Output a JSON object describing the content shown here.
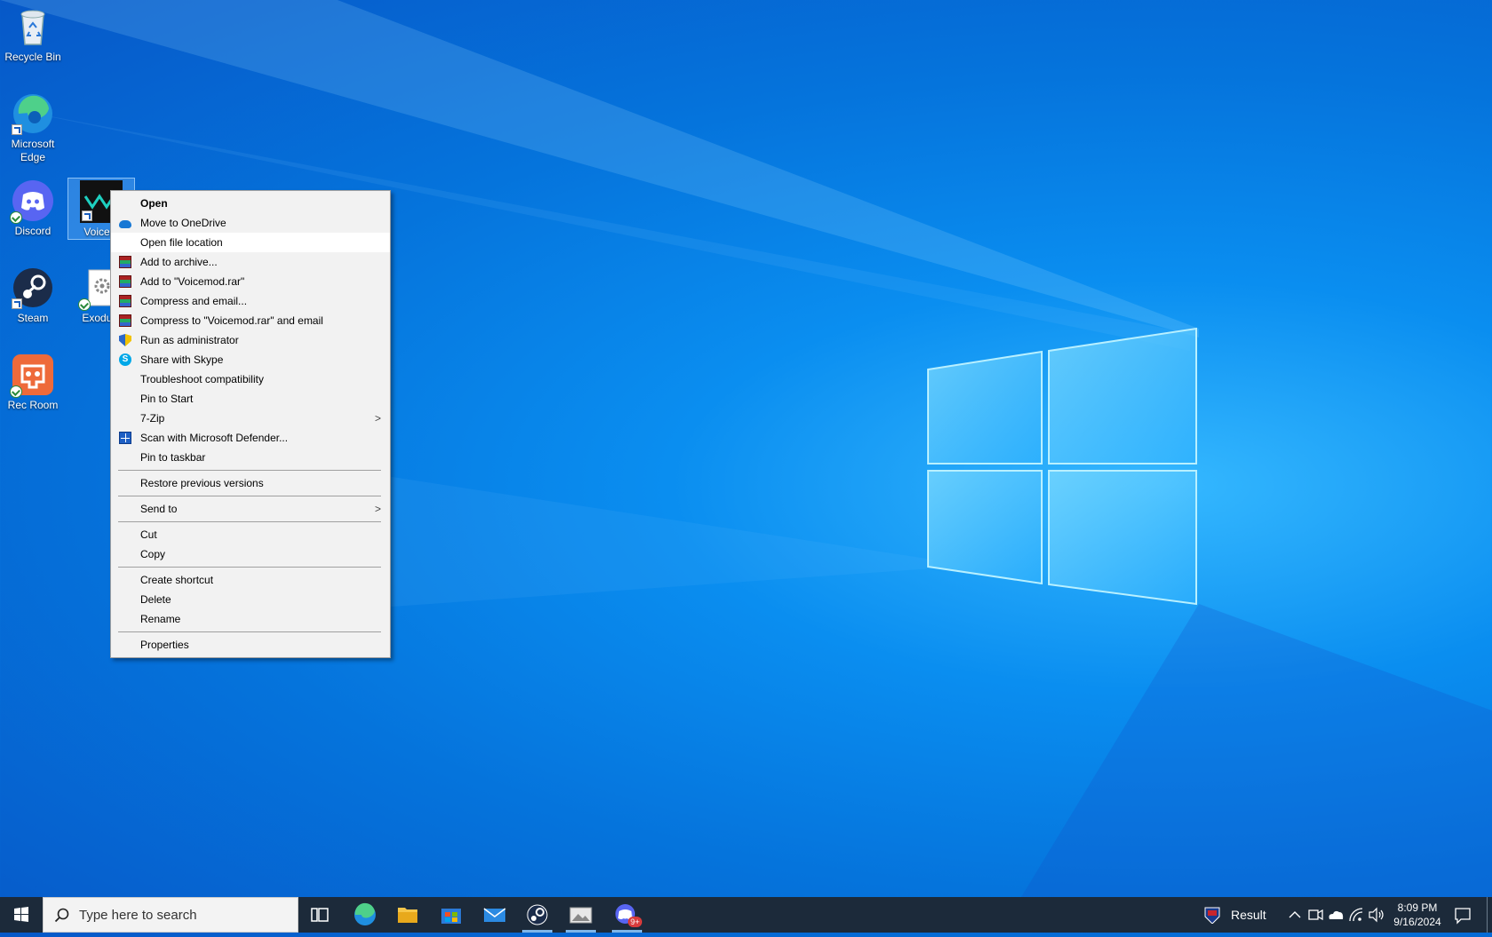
{
  "desktop": {
    "icons": [
      {
        "label": "Recycle Bin",
        "icon": "recycle-bin-icon"
      },
      {
        "label": "Microsoft Edge",
        "icon": "edge-icon"
      },
      {
        "label": "Discord",
        "icon": "discord-icon"
      },
      {
        "label": "Voicem",
        "icon": "voicemod-icon"
      },
      {
        "label": "Steam",
        "icon": "steam-icon"
      },
      {
        "label": "Exodus.",
        "icon": "settings-file-icon"
      },
      {
        "label": "Rec Room",
        "icon": "rec-room-icon"
      }
    ]
  },
  "context_menu": {
    "items": [
      {
        "label": "Open",
        "icon": ""
      },
      {
        "label": "Move to OneDrive",
        "icon": "onedrive-icon"
      },
      {
        "label": "Open file location",
        "icon": ""
      },
      {
        "label": "Add to archive...",
        "icon": "winrar-icon"
      },
      {
        "label": "Add to \"Voicemod.rar\"",
        "icon": "winrar-icon"
      },
      {
        "label": "Compress and email...",
        "icon": "winrar-icon"
      },
      {
        "label": "Compress to \"Voicemod.rar\" and email",
        "icon": "winrar-icon"
      },
      {
        "label": "Run as administrator",
        "icon": "uac-shield-icon"
      },
      {
        "label": "Share with Skype",
        "icon": "skype-icon"
      },
      {
        "label": "Troubleshoot compatibility",
        "icon": ""
      },
      {
        "label": "Pin to Start",
        "icon": ""
      },
      {
        "label": "7-Zip",
        "icon": ""
      },
      {
        "label": "Scan with Microsoft Defender...",
        "icon": "defender-icon"
      },
      {
        "label": "Pin to taskbar",
        "icon": ""
      },
      {
        "label": "Restore previous versions",
        "icon": ""
      },
      {
        "label": "Send to",
        "icon": ""
      },
      {
        "label": "Cut",
        "icon": ""
      },
      {
        "label": "Copy",
        "icon": ""
      },
      {
        "label": "Create shortcut",
        "icon": ""
      },
      {
        "label": "Delete",
        "icon": ""
      },
      {
        "label": "Rename",
        "icon": ""
      },
      {
        "label": "Properties",
        "icon": ""
      }
    ],
    "submenu_arrow": ">",
    "skype_glyph": "S"
  },
  "taskbar": {
    "search_placeholder": "Type here to search",
    "apps": [
      "task-view-icon",
      "edge-icon",
      "file-explorer-icon",
      "store-icon",
      "mail-icon",
      "steam-icon",
      "photos-icon",
      "discord-icon"
    ],
    "discord_badge": "9+",
    "widget_label": "Result",
    "time": "8:09 PM",
    "date": "9/16/2024"
  },
  "colors": {
    "accent": "#0078d7",
    "taskbar": "#1c2a3a",
    "menu_bg": "#f2f2f2"
  }
}
